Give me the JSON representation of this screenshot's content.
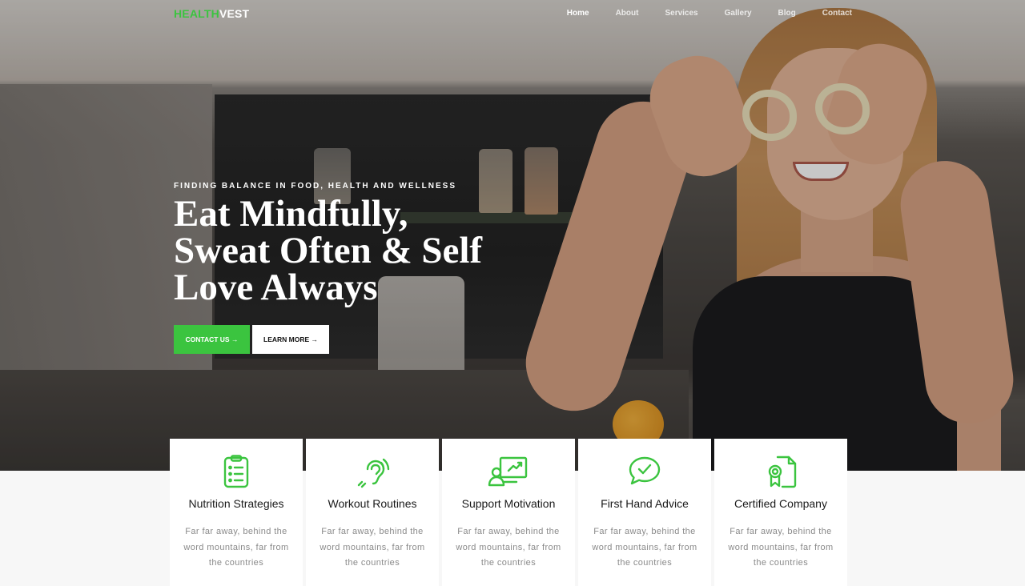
{
  "brand": {
    "part1": "HEALTH",
    "part2": "VEST",
    "accent": "#3bc43f"
  },
  "nav": {
    "items": [
      {
        "label": "Home",
        "active": true
      },
      {
        "label": "About"
      },
      {
        "label": "Services"
      },
      {
        "label": "Gallery"
      },
      {
        "label": "Blog"
      },
      {
        "label": "Contact"
      }
    ]
  },
  "hero": {
    "eyebrow": "FINDING BALANCE IN FOOD, HEALTH AND WELLNESS",
    "headline_line1": "Eat Mindfully,",
    "headline_line2": "Sweat Often & Self",
    "headline_line3": "Love Always",
    "contact_button": "CONTACT US →",
    "learn_button": "LEARN MORE →",
    "image": "woman-holding-pepper-rings-photo"
  },
  "features": [
    {
      "icon": "clipboard-list-icon",
      "title": "Nutrition Strategies",
      "text": "Far far away, behind the word mountains, far from the countries"
    },
    {
      "icon": "hearing-icon",
      "title": "Workout Routines",
      "text": "Far far away, behind the word mountains, far from the countries"
    },
    {
      "icon": "presentation-icon",
      "title": "Support Motivation",
      "text": "Far far away, behind the word mountains, far from the countries"
    },
    {
      "icon": "chat-check-icon",
      "title": "First Hand Advice",
      "text": "Far far away, behind the word mountains, far from the countries"
    },
    {
      "icon": "certificate-icon",
      "title": "Certified Company",
      "text": "Far far away, behind the word mountains, far from the countries"
    }
  ]
}
